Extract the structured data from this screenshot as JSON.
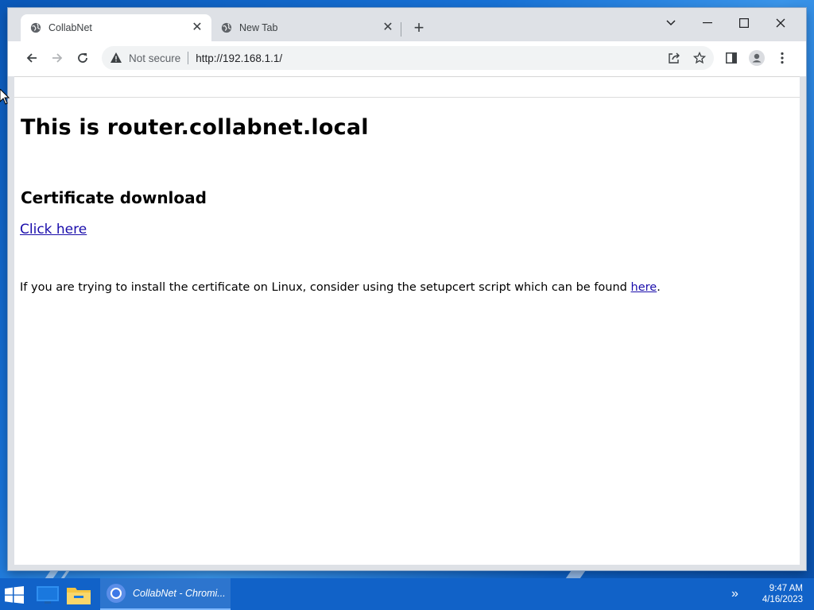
{
  "browser": {
    "tabs": [
      {
        "title": "CollabNet",
        "active": true
      },
      {
        "title": "New Tab",
        "active": false
      }
    ],
    "new_tab_icon": "plus-icon",
    "window_controls": [
      "tab-search-icon",
      "minimize-icon",
      "maximize-icon",
      "close-icon"
    ],
    "address_bar": {
      "security_label": "Not secure",
      "url": "http://192.168.1.1/"
    },
    "toolbar_icons": [
      "back-icon",
      "forward-icon",
      "reload-icon",
      "share-icon",
      "bookmark-star-icon",
      "side-panel-icon",
      "profile-icon",
      "menu-icon"
    ]
  },
  "page": {
    "heading": "This is router.collabnet.local",
    "subheading": "Certificate download",
    "download_link": "Click here",
    "note_text": "If you are trying to install the certificate on Linux, consider using the setupcert script which can be found ",
    "note_link": "here",
    "note_end": "."
  },
  "taskbar": {
    "active_app_label": "CollabNet - Chromi...",
    "clock_time": "9:47 AM",
    "clock_date": "4/16/2023"
  },
  "colors": {
    "link": "#1a0dab",
    "taskbar": "#1162c8",
    "tabstrip": "#dee1e6"
  }
}
